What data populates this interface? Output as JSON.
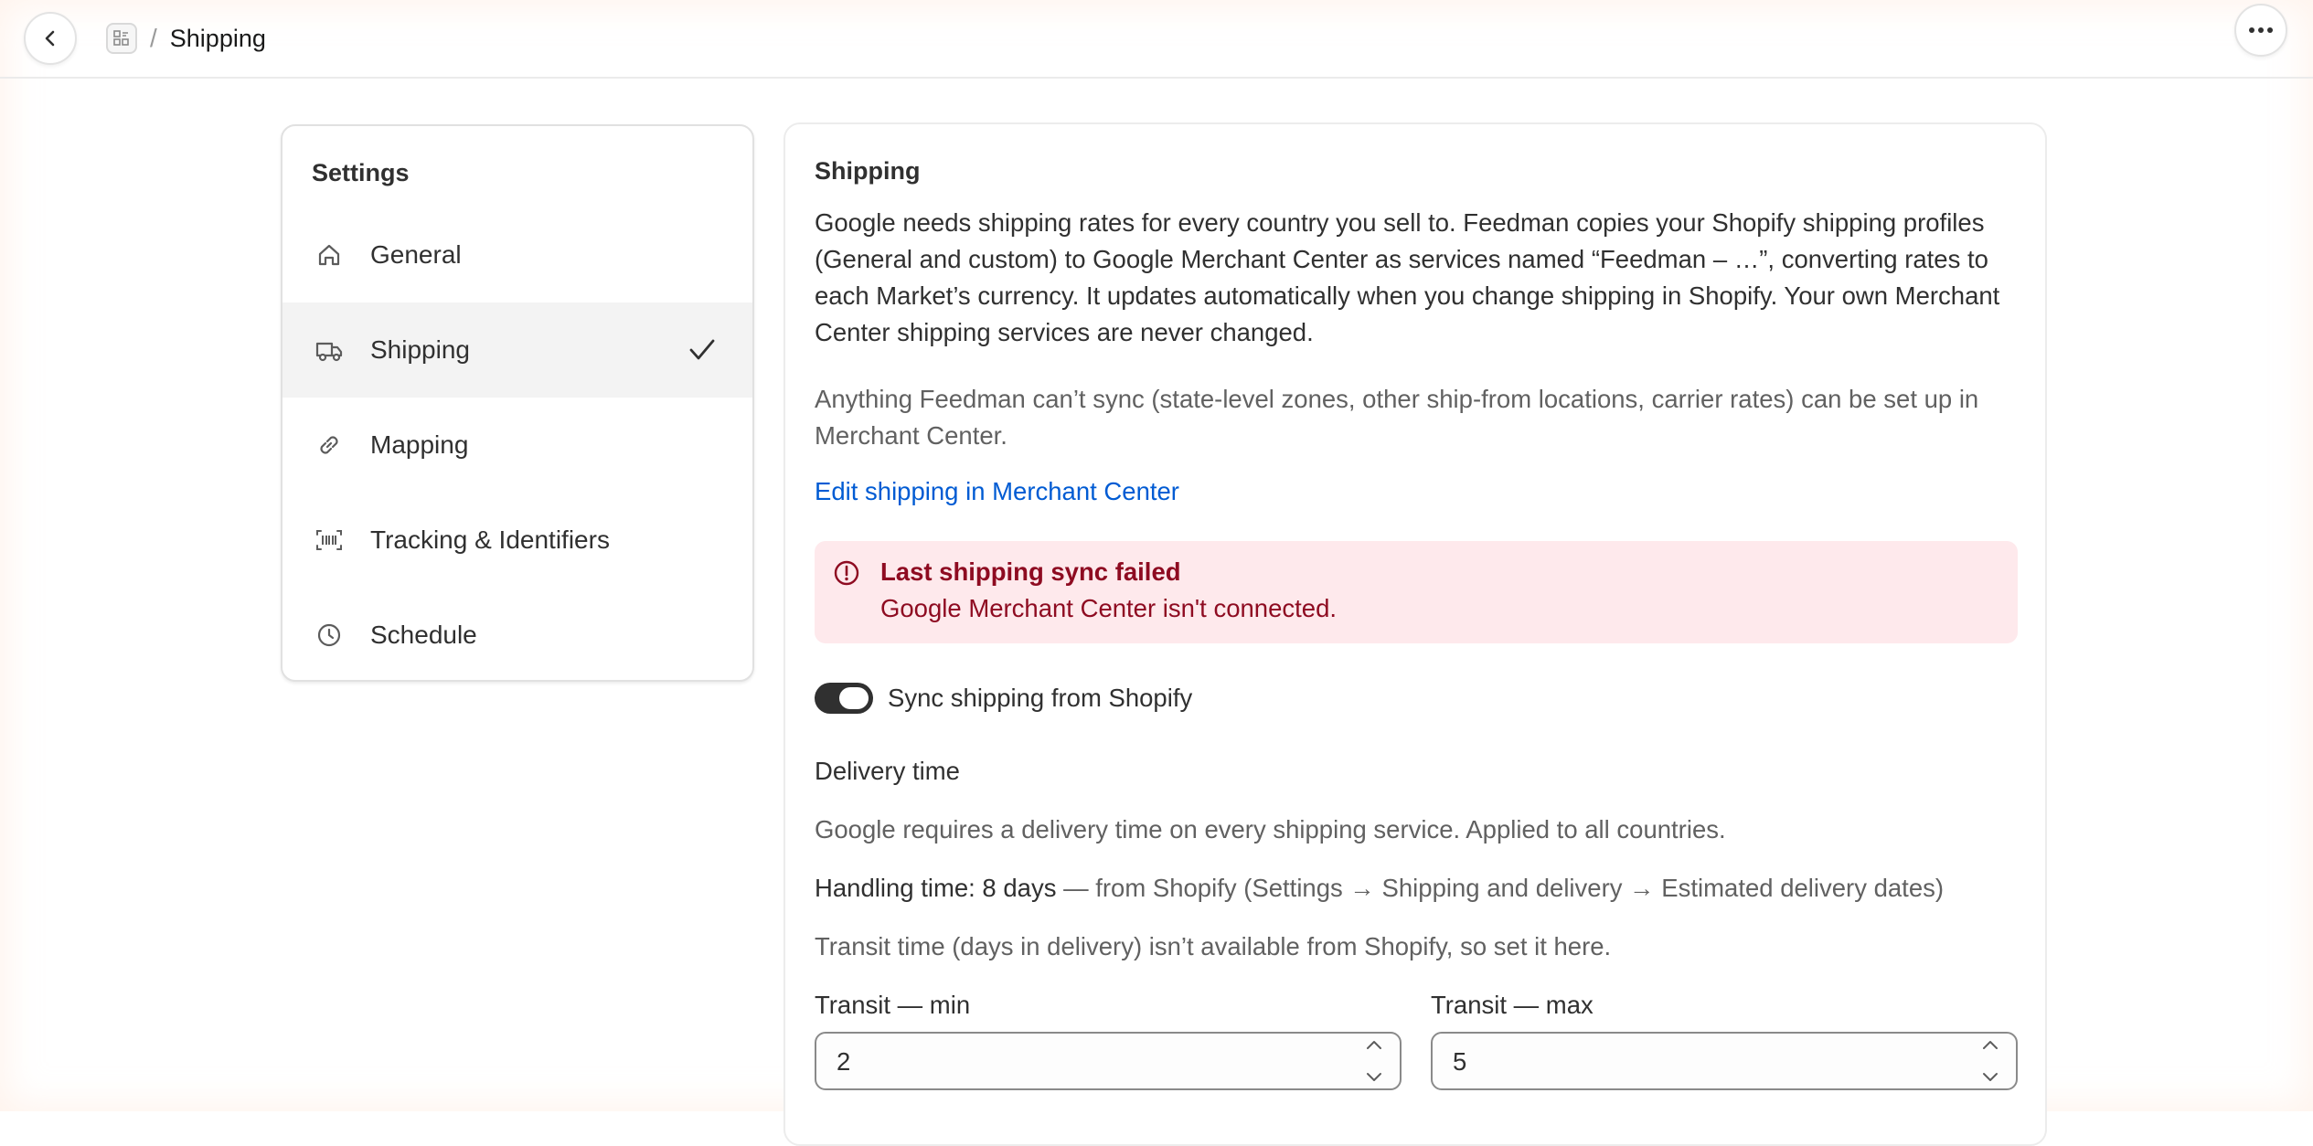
{
  "header": {
    "breadcrumb_separator": "/",
    "title": "Shipping"
  },
  "sidebar": {
    "heading": "Settings",
    "items": [
      {
        "label": "General",
        "icon": "home-icon"
      },
      {
        "label": "Shipping",
        "icon": "truck-icon",
        "active": true
      },
      {
        "label": "Mapping",
        "icon": "link-icon"
      },
      {
        "label": "Tracking & Identifiers",
        "icon": "barcode-icon"
      },
      {
        "label": "Schedule",
        "icon": "clock-icon"
      }
    ]
  },
  "main": {
    "title": "Shipping",
    "intro": "Google needs shipping rates for every country you sell to. Feedman copies your Shopify shipping profiles (General and custom) to Google Merchant Center as services named “Feedman – …”, converting rates to each Market’s currency. It updates automatically when you change shipping in Shopify. Your own Merchant Center shipping services are never changed.",
    "note": "Anything Feedman can’t sync (state-level zones, other ship-from locations, carrier rates) can be set up in Merchant Center.",
    "link": "Edit shipping in Merchant Center",
    "banner": {
      "title": "Last shipping sync failed",
      "text": "Google Merchant Center isn't connected."
    },
    "toggle": {
      "label": "Sync shipping from Shopify",
      "on": true
    },
    "delivery": {
      "heading": "Delivery time",
      "requirement": "Google requires a delivery time on every shipping service. Applied to all countries.",
      "handling_label": "Handling time: 8 days",
      "handling_source": " — from Shopify (Settings → Shipping and delivery → Estimated delivery dates)",
      "transit_note": "Transit time (days in delivery) isn’t available from Shopify, so set it here.",
      "transit_min_label": "Transit — min",
      "transit_min_value": "2",
      "transit_max_label": "Transit — max",
      "transit_max_value": "5"
    }
  },
  "colors": {
    "link": "#005bd3",
    "critical_bg": "#fee9ec",
    "critical_text": "#8e0b21",
    "toggle_on": "#303030"
  }
}
